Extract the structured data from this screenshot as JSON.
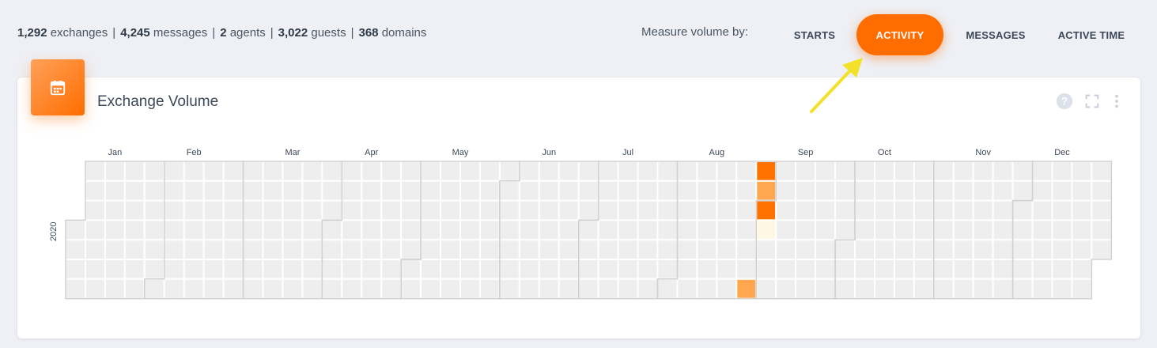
{
  "stats": {
    "exchanges_count": "1,292",
    "exchanges_label": "exchanges",
    "messages_count": "4,245",
    "messages_label": "messages",
    "agents_count": "2",
    "agents_label": "agents",
    "guests_count": "3,022",
    "guests_label": "guests",
    "domains_count": "368",
    "domains_label": "domains",
    "separator": "|"
  },
  "measure": {
    "label": "Measure volume by:",
    "options": [
      {
        "label": "STARTS",
        "active": false
      },
      {
        "label": "ACTIVITY",
        "active": true
      },
      {
        "label": "MESSAGES",
        "active": false
      },
      {
        "label": "ACTIVE TIME",
        "active": false
      }
    ]
  },
  "card": {
    "title": "Exchange Volume",
    "icon": "calendar-icon",
    "tools": [
      "help-icon",
      "fullscreen-icon",
      "more-vertical-icon"
    ]
  },
  "colors": {
    "accent": "#ff6d00",
    "accent_light": "#ffa15a",
    "empty_cell": "#eeeeee",
    "cell_border": "#ffffff",
    "month_border": "#d0d0d0",
    "arrow": "#f2e128"
  },
  "chart_data": {
    "type": "heatmap",
    "year": 2020,
    "year_label": "2020",
    "months": [
      "Jan",
      "Feb",
      "Mar",
      "Apr",
      "May",
      "Jun",
      "Jul",
      "Aug",
      "Sep",
      "Oct",
      "Nov",
      "Dec"
    ],
    "week_start": "sunday",
    "colored_days": [
      {
        "date": "2020-08-29",
        "level": "medium"
      },
      {
        "date": "2020-08-30",
        "level": "high"
      },
      {
        "date": "2020-08-31",
        "level": "medium"
      },
      {
        "date": "2020-09-01",
        "level": "high"
      },
      {
        "date": "2020-09-02",
        "level": "low"
      }
    ],
    "level_colors": {
      "high": "#ff7200",
      "medium": "#ffa64f",
      "low": "#fdf7e3"
    }
  }
}
